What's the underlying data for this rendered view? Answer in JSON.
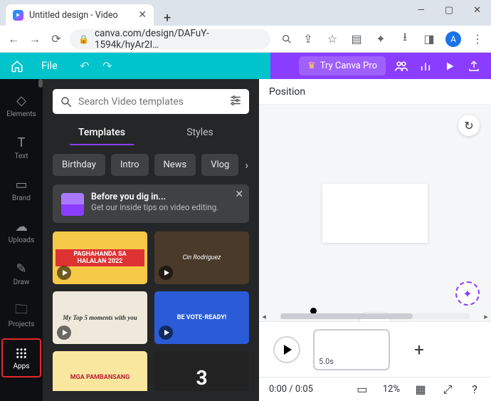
{
  "window": {
    "tab_title": "Untitled design - Video"
  },
  "url": "canva.com/design/DAFuY-1594k/hyAr2I…",
  "avatar_letter": "A",
  "topbar": {
    "file": "File",
    "try_pro": "Try Canva Pro"
  },
  "rail": {
    "items": [
      {
        "label": "Elements"
      },
      {
        "label": "Text"
      },
      {
        "label": "Brand"
      },
      {
        "label": "Uploads"
      },
      {
        "label": "Draw"
      },
      {
        "label": "Projects"
      },
      {
        "label": "Apps"
      }
    ]
  },
  "panel": {
    "search_placeholder": "Search Video templates",
    "tabs": {
      "templates": "Templates",
      "styles": "Styles"
    },
    "chips": [
      "Birthday",
      "Intro",
      "News",
      "Vlog"
    ],
    "banner": {
      "title": "Before you dig in...",
      "sub": "Get our inside tips on video editing."
    },
    "cards": [
      "PAGHAHANDA SA HALALAN 2022",
      "Cin Rodriguez",
      "My Top 5 moments with you",
      "BE VOTE-READY!",
      "MGA PAMBANSANG",
      "3"
    ]
  },
  "context": {
    "position": "Position"
  },
  "timeline": {
    "clip_duration": "5.0s"
  },
  "bottombar": {
    "time": "0:00 / 0:05",
    "zoom": "12%"
  }
}
